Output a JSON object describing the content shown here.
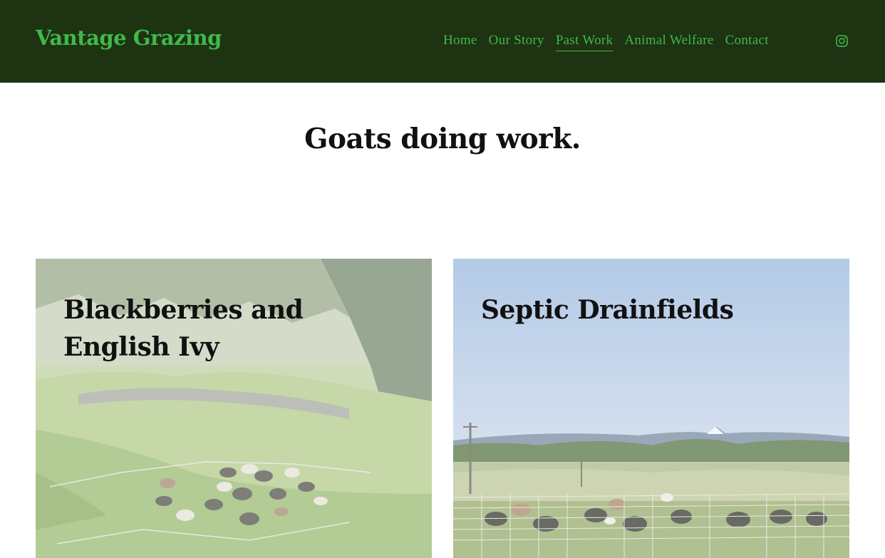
{
  "header": {
    "logo": "Vantage Grazing",
    "nav": [
      {
        "label": "Home"
      },
      {
        "label": "Our Story"
      },
      {
        "label": "Past Work"
      },
      {
        "label": "Animal Welfare"
      },
      {
        "label": "Contact"
      }
    ],
    "active_nav": "Past Work",
    "social_icon": "instagram-icon"
  },
  "main": {
    "title": "Goats doing work.",
    "cards": [
      {
        "title": "Blackberries and English Ivy"
      },
      {
        "title": "Septic Drainfields"
      }
    ]
  },
  "colors": {
    "header_bg": "#1d3312",
    "accent": "#3fb94a",
    "text": "#111111"
  }
}
